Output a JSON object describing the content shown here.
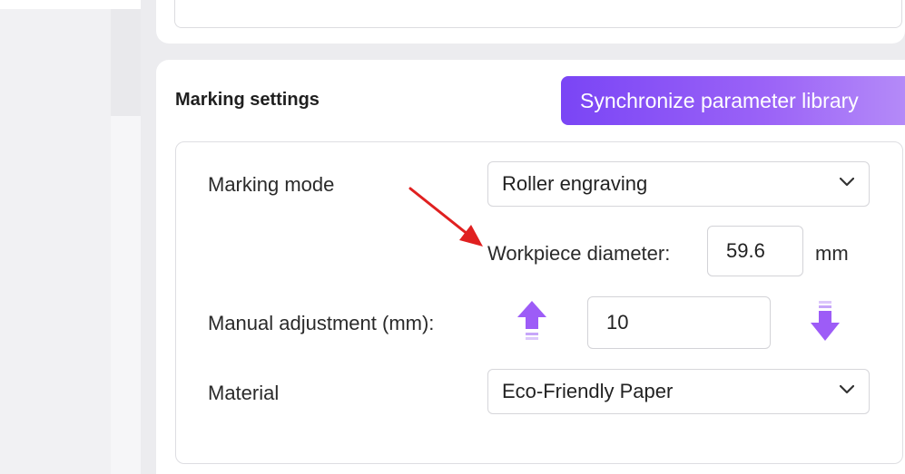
{
  "marking_settings": {
    "title": "Marking settings",
    "sync_button_label": "Synchronize parameter library",
    "marking_mode": {
      "label": "Marking mode",
      "value": "Roller engraving"
    },
    "workpiece_diameter": {
      "label": "Workpiece diameter:",
      "value": "59.6",
      "unit": "mm"
    },
    "manual_adjustment": {
      "label": "Manual adjustment (mm):",
      "value": "10"
    },
    "material": {
      "label": "Material",
      "value": "Eco-Friendly Paper"
    }
  },
  "colors": {
    "accent_purple": "#9d5cf7",
    "annotation_red": "#e02020"
  },
  "icons": {
    "up": "arrow-up-icon",
    "down": "arrow-down-icon",
    "chevron": "chevron-down-icon",
    "annotation": "red-annotation-arrow"
  }
}
